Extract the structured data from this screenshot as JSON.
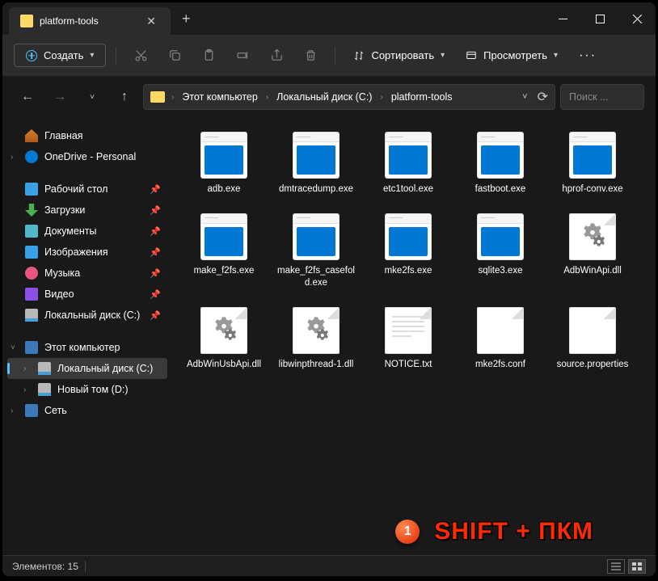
{
  "tab": {
    "title": "platform-tools"
  },
  "toolbar": {
    "create": "Создать",
    "sort": "Сортировать",
    "view": "Просмотреть"
  },
  "breadcrumb": {
    "items": [
      "Этот компьютер",
      "Локальный диск (C:)",
      "platform-tools"
    ]
  },
  "search": {
    "placeholder": "Поиск ..."
  },
  "sidebar": {
    "home": "Главная",
    "onedrive": "OneDrive - Personal",
    "quick": [
      {
        "label": "Рабочий стол",
        "icon": "desk"
      },
      {
        "label": "Загрузки",
        "icon": "down"
      },
      {
        "label": "Документы",
        "icon": "docs"
      },
      {
        "label": "Изображения",
        "icon": "pics"
      },
      {
        "label": "Музыка",
        "icon": "music"
      },
      {
        "label": "Видео",
        "icon": "video"
      },
      {
        "label": "Локальный диск (C:)",
        "icon": "disk"
      }
    ],
    "pc": "Этот компьютер",
    "drives": [
      {
        "label": "Локальный диск (C:)",
        "active": true
      },
      {
        "label": "Новый том (D:)",
        "active": false
      }
    ],
    "network": "Сеть"
  },
  "files": [
    {
      "name": "adb.exe",
      "type": "exe"
    },
    {
      "name": "dmtracedump.exe",
      "type": "exe"
    },
    {
      "name": "etc1tool.exe",
      "type": "exe"
    },
    {
      "name": "fastboot.exe",
      "type": "exe"
    },
    {
      "name": "hprof-conv.exe",
      "type": "exe"
    },
    {
      "name": "make_f2fs.exe",
      "type": "exe"
    },
    {
      "name": "make_f2fs_casefold.exe",
      "type": "exe"
    },
    {
      "name": "mke2fs.exe",
      "type": "exe"
    },
    {
      "name": "sqlite3.exe",
      "type": "exe"
    },
    {
      "name": "AdbWinApi.dll",
      "type": "dll"
    },
    {
      "name": "AdbWinUsbApi.dll",
      "type": "dll"
    },
    {
      "name": "libwinpthread-1.dll",
      "type": "dll"
    },
    {
      "name": "NOTICE.txt",
      "type": "txt"
    },
    {
      "name": "mke2fs.conf",
      "type": "blank"
    },
    {
      "name": "source.properties",
      "type": "blank"
    }
  ],
  "status": {
    "label": "Элементов: 15"
  },
  "annotation": {
    "num": "1",
    "text": "SHIFT + ПКМ"
  }
}
